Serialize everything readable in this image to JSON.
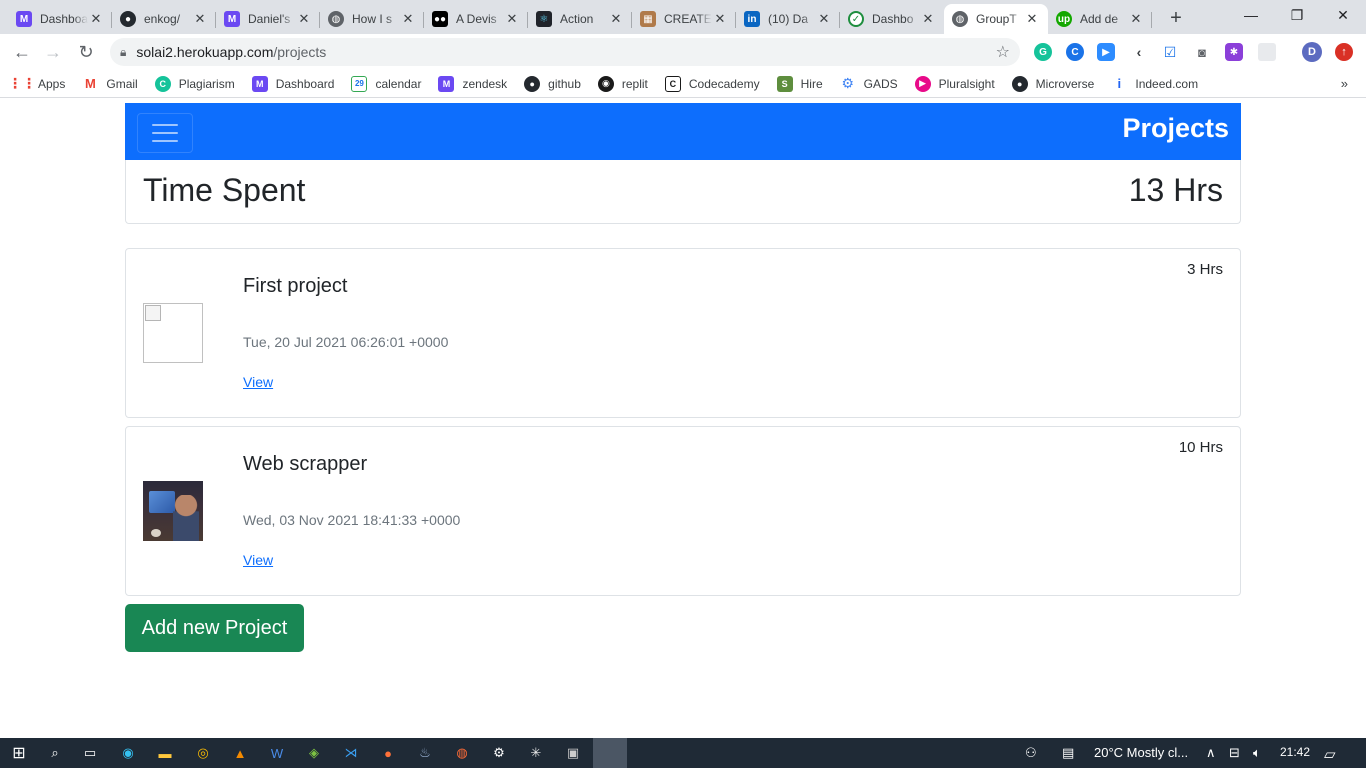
{
  "browser": {
    "tabs": [
      {
        "title": "Dashboard",
        "favicon": "microverse-icon",
        "color": "#6b49f2"
      },
      {
        "title": "enkog/",
        "favicon": "github-icon",
        "color": "#24292f"
      },
      {
        "title": "Daniel's",
        "favicon": "microverse-icon",
        "color": "#6b49f2"
      },
      {
        "title": "How I s",
        "favicon": "globe-icon",
        "color": "#5f6368"
      },
      {
        "title": "A Devis",
        "favicon": "medium-icon",
        "color": "#000000"
      },
      {
        "title": "Action",
        "favicon": "react-icon",
        "color": "#20232a"
      },
      {
        "title": "CREATE",
        "favicon": "image-icon",
        "color": "#b07a4a"
      },
      {
        "title": "(10) Da",
        "favicon": "linkedin-icon",
        "color": "#0a66c2"
      },
      {
        "title": "Dashbo",
        "favicon": "check-icon",
        "color": "#1e8e3e"
      },
      {
        "title": "GroupT",
        "favicon": "globe-icon",
        "color": "#5f6368",
        "active": true
      },
      {
        "title": "Add de",
        "favicon": "upwork-icon",
        "color": "#14a800"
      }
    ],
    "url_host": "solai2.herokuapp.com",
    "url_path": "/projects",
    "profile_initial": "D",
    "bookmarks": [
      {
        "label": "Apps",
        "icon": "apps-grid-icon",
        "color": "#ea4335"
      },
      {
        "label": "Gmail",
        "icon": "gmail-icon",
        "color": "#ea4335"
      },
      {
        "label": "Plagiarism",
        "icon": "plagiarism-icon",
        "color": "#15c39a"
      },
      {
        "label": "Dashboard",
        "icon": "microverse-icon",
        "color": "#6b49f2"
      },
      {
        "label": "calendar",
        "icon": "calendar-icon",
        "color": "#34a853"
      },
      {
        "label": "zendesk",
        "icon": "microverse-icon",
        "color": "#6b49f2"
      },
      {
        "label": "github",
        "icon": "github-icon",
        "color": "#24292f"
      },
      {
        "label": "replit",
        "icon": "replit-icon",
        "color": "#1a1a1a"
      },
      {
        "label": "Codecademy",
        "icon": "codecademy-icon",
        "color": "#1a1a1a"
      },
      {
        "label": "Hire",
        "icon": "shopify-icon",
        "color": "#5e8e3e"
      },
      {
        "label": "GADS",
        "icon": "gads-icon",
        "color": "#4285f4"
      },
      {
        "label": "Pluralsight",
        "icon": "pluralsight-icon",
        "color": "#e80a89"
      },
      {
        "label": "Microverse",
        "icon": "github-icon",
        "color": "#24292f"
      },
      {
        "label": "Indeed.com",
        "icon": "indeed-icon",
        "color": "#2164f3"
      }
    ]
  },
  "page": {
    "navbar_brand": "Projects",
    "time_spent_label": "Time Spent",
    "time_spent_value": "13 Hrs",
    "projects": [
      {
        "title": "First project",
        "date": "Tue, 20 Jul 2021 06:26:01 +0000",
        "hours": "3 Hrs",
        "view_label": "View",
        "image": "broken-image"
      },
      {
        "title": "Web scrapper",
        "date": "Wed, 03 Nov 2021 18:41:33 +0000",
        "hours": "10 Hrs",
        "view_label": "View",
        "image": "photo"
      }
    ],
    "add_button": "Add new Project"
  },
  "taskbar": {
    "weather": "20°C  Mostly cl...",
    "time": "21:42"
  }
}
